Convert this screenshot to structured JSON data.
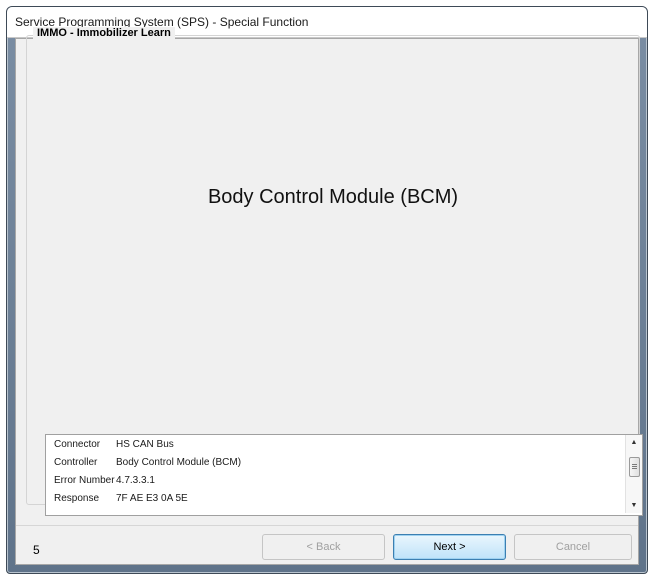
{
  "window": {
    "title": "Service Programming System (SPS) - Special Function"
  },
  "group": {
    "label": "IMMO - Immobilizer Learn"
  },
  "main": {
    "module_title": "Body Control Module (BCM)"
  },
  "details": {
    "rows": [
      {
        "label": "Connector",
        "value": "HS CAN Bus"
      },
      {
        "label": "Controller",
        "value": "Body Control Module (BCM)"
      },
      {
        "label": "Error Number",
        "value": "4.7.3.3.1"
      },
      {
        "label": "Response",
        "value": "7F AE E3 0A 5E"
      }
    ]
  },
  "footer": {
    "step": "5",
    "back_label": "< Back",
    "next_label": "Next >",
    "cancel_label": "Cancel"
  },
  "icons": {
    "scroll_up": "scroll-up-arrow-icon",
    "scroll_down": "scroll-down-arrow-icon"
  }
}
